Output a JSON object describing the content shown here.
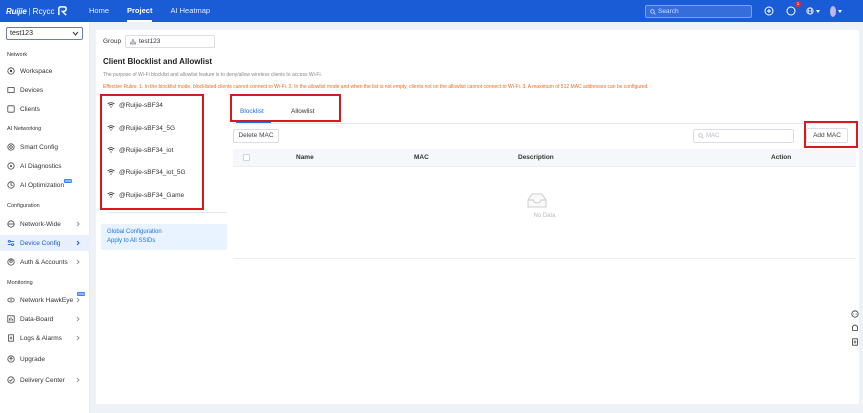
{
  "header": {
    "brand": "Ruijie",
    "sep": "|",
    "product": "Rcycc",
    "nav": [
      "Home",
      "Project",
      "AI Heatmap"
    ],
    "search_placeholder": "Search",
    "notification_count": "1"
  },
  "sidebar": {
    "project": "test123",
    "sections": [
      "Network",
      "AI Networking",
      "Configuration",
      "Monitoring"
    ],
    "items": [
      {
        "label": "Workspace"
      },
      {
        "label": "Devices"
      },
      {
        "label": "Clients"
      },
      {
        "label": "Smart Config"
      },
      {
        "label": "AI Diagnostics"
      },
      {
        "label": "AI Optimization"
      },
      {
        "label": "Network-Wide"
      },
      {
        "label": "Device Config"
      },
      {
        "label": "Auth & Accounts"
      },
      {
        "label": "Network HawkEye"
      },
      {
        "label": "Data-Board"
      },
      {
        "label": "Logs & Alarms"
      },
      {
        "label": "Upgrade"
      },
      {
        "label": "Delivery Center"
      }
    ],
    "new_badge": "new"
  },
  "main": {
    "group_label": "Group",
    "group_value": "test123",
    "title": "Client Blocklist and Allowlist",
    "purpose": "The purpose of Wi-Fi blocklist and allowlist feature is to deny/allow wireless clients to access Wi-Fi.",
    "rules": "Effective Rules: 1. In the blocklist mode, blocklisted clients cannot connect to Wi-Fi. 2. In the allowlist mode and when the list is not empty, clients not on the allowlist cannot connect to Wi-Fi. 3. A maximum of 512 MAC addresses can be configured.",
    "ssids": [
      "@Ruijie-sBF34",
      "@Ruijie-sBF34_5G",
      "@Ruijie-sBF34_iot",
      "@Ruijie-sBF34_iot_5G",
      "@Ruijie-sBF34_Game"
    ],
    "global_line1": "Global Configuration",
    "global_line2": "Apply to All SSIDs",
    "tabs": [
      "Blocklist",
      "Allowlist"
    ],
    "delete_button": "Delete MAC",
    "search_placeholder": "MAC",
    "add_button": "Add MAC",
    "columns": [
      "Name",
      "MAC",
      "Description",
      "Action"
    ],
    "empty_text": "No Data"
  },
  "colors": {
    "accent": "#1a5bd6",
    "highlight": "#d71920",
    "warning_text": "#f26b1d"
  }
}
